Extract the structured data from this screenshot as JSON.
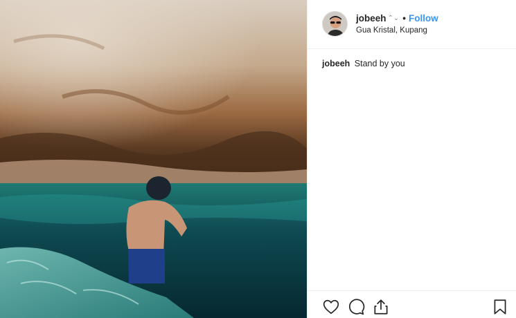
{
  "post": {
    "username": "jobeeh",
    "verified_glyph": "⌃⌄",
    "separator": "•",
    "follow_label": "Follow",
    "location": "Gua Kristal, Kupang",
    "caption_user": "jobeeh",
    "caption_text": "Stand by you"
  },
  "icons": {
    "like": "heart-icon",
    "comment": "comment-icon",
    "share": "share-icon",
    "save": "bookmark-icon"
  },
  "colors": {
    "follow": "#3897f0",
    "text": "#262626",
    "divider": "#efefef"
  }
}
